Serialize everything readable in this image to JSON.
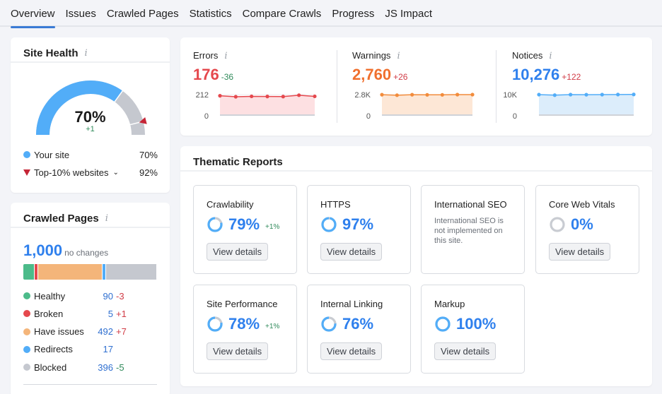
{
  "tabs": [
    {
      "label": "Overview",
      "active": true
    },
    {
      "label": "Issues",
      "active": false
    },
    {
      "label": "Crawled Pages",
      "active": false
    },
    {
      "label": "Statistics",
      "active": false
    },
    {
      "label": "Compare Crawls",
      "active": false
    },
    {
      "label": "Progress",
      "active": false
    },
    {
      "label": "JS Impact",
      "active": false
    }
  ],
  "site_health": {
    "title": "Site Health",
    "info_icon": "i",
    "score": "70%",
    "score_value": 70,
    "top10_value": 92,
    "delta": "+1",
    "legend": [
      {
        "label": "Your site",
        "value": "70%",
        "color": "#52adf8"
      },
      {
        "label": "Top-10% websites",
        "value": "92%",
        "color": "#c52536"
      }
    ]
  },
  "crawled_pages": {
    "title": "Crawled Pages",
    "info_icon": "i",
    "total": "1,000",
    "total_note": "no changes",
    "rows": [
      {
        "label": "Healthy",
        "value": "90",
        "count": 90,
        "change": "-3",
        "change_color": "#d13c46",
        "color": "#4cbb8a"
      },
      {
        "label": "Broken",
        "value": "5",
        "count": 5,
        "change": "+1",
        "change_color": "#d13c46",
        "color": "#e5484d"
      },
      {
        "label": "Have issues",
        "value": "492",
        "count": 492,
        "change": "+7",
        "change_color": "#d13c46",
        "color": "#f4b57a"
      },
      {
        "label": "Redirects",
        "value": "17",
        "count": 17,
        "change": "",
        "change_color": "#d13c46",
        "color": "#52adf8"
      },
      {
        "label": "Blocked",
        "value": "396",
        "count": 396,
        "change": "-5",
        "change_color": "#2f8a5a",
        "color": "#c5c8cf"
      }
    ]
  },
  "issues_summary": {
    "metrics": [
      {
        "label": "Errors",
        "value": "176",
        "delta": "-36",
        "value_color": "#e5484d",
        "delta_color": "#2f8a5a",
        "axis_max": "212",
        "axis_min": "0",
        "ymax": 212,
        "series": [
          200,
          190,
          194,
          193,
          192,
          206,
          194
        ],
        "line_color": "#e5484d",
        "fill_color": "#fde0e2"
      },
      {
        "label": "Warnings",
        "value": "2,760",
        "delta": "+26",
        "value_color": "#f0702e",
        "delta_color": "#d13c46",
        "axis_max": "2.8K",
        "axis_min": "0",
        "ymax": 2800,
        "series": [
          2790,
          2720,
          2790,
          2770,
          2770,
          2800,
          2800
        ],
        "line_color": "#f28c3c",
        "fill_color": "#fde7d6"
      },
      {
        "label": "Notices",
        "value": "10,276",
        "delta": "+122",
        "value_color": "#2f80ed",
        "delta_color": "#d13c46",
        "axis_max": "10K",
        "axis_min": "0",
        "ymax": 10000,
        "series": [
          10000,
          9750,
          10000,
          9950,
          10000,
          10050,
          10080
        ],
        "line_color": "#52adf8",
        "fill_color": "#dcedfb"
      }
    ]
  },
  "thematic_reports": {
    "title": "Thematic Reports",
    "view_details_label": "View details",
    "reports": [
      {
        "title": "Crawlability",
        "score": "79%",
        "pct": 79,
        "delta": "+1%",
        "note": null
      },
      {
        "title": "HTTPS",
        "score": "97%",
        "pct": 97,
        "delta": "",
        "note": null
      },
      {
        "title": "International SEO",
        "score": null,
        "pct": null,
        "delta": "",
        "note": "International SEO is not implemented on this site."
      },
      {
        "title": "Core Web Vitals",
        "score": "0%",
        "pct": 0,
        "delta": "",
        "note": null
      },
      {
        "title": "Site Performance",
        "score": "78%",
        "pct": 78,
        "delta": "+1%",
        "note": null
      },
      {
        "title": "Internal Linking",
        "score": "76%",
        "pct": 76,
        "delta": "",
        "note": null
      },
      {
        "title": "Markup",
        "score": "100%",
        "pct": 100,
        "delta": "",
        "note": null
      }
    ]
  }
}
